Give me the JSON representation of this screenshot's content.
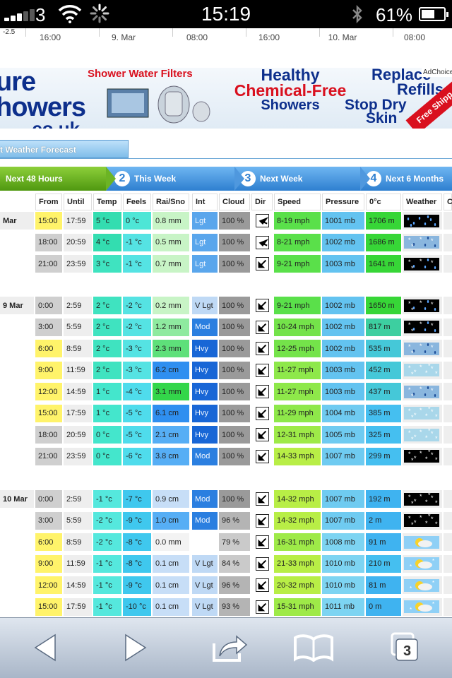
{
  "status_bar": {
    "carrier": "3",
    "time": "15:19",
    "battery": "61%",
    "battery_level": 0.61
  },
  "time_axis": {
    "y_label": "-2.5",
    "ticks": [
      "16:00",
      "9. Mar",
      "08:00",
      "16:00",
      "10. Mar",
      "08:00"
    ]
  },
  "banner": {
    "logo_line1": "ure",
    "logo_line2": "howers",
    "logo_line3": ".co.uk",
    "filters": "Shower Water Filters",
    "healthy1": "Healthy",
    "healthy2": "Chemical-Free",
    "healthy3": "Showers",
    "replace1": "Replace",
    "replace2": "Refills",
    "stop1": "Stop Dry",
    "stop2": "Skin",
    "ad_choices": "AdChoice",
    "free_ship": "Free Shipp"
  },
  "forecast_tab": "t Weather Forecast",
  "steps": [
    {
      "number": "",
      "label": "Next 48 Hours"
    },
    {
      "number": "2",
      "label": "This Week"
    },
    {
      "number": "3",
      "label": "Next Week"
    },
    {
      "number": "4",
      "label": "Next 6 Months"
    }
  ],
  "columns": [
    "From",
    "Until",
    "Temp",
    "Feels",
    "Rai/Sno",
    "Int",
    "Cloud",
    "Dir",
    "Speed",
    "Pressure",
    "0°c",
    "Weather",
    "C"
  ],
  "days": [
    {
      "label": "Mar",
      "rows": [
        {
          "from": "15:00",
          "until": "17:59",
          "temp": "5 °c",
          "feels": "0 °c",
          "precip": "0.8 mm",
          "int": "Lgt",
          "cloud": "100 %",
          "dir": "left",
          "speed": "8-19 mph",
          "pressure": "1001 mb",
          "freeze": "1706 m",
          "weather": "rain-night"
        },
        {
          "from": "18:00",
          "until": "20:59",
          "temp": "4 °c",
          "feels": "-1 °c",
          "precip": "0.5 mm",
          "int": "Lgt",
          "cloud": "100 %",
          "dir": "left",
          "speed": "8-21 mph",
          "pressure": "1002 mb",
          "freeze": "1686 m",
          "weather": "sleet"
        },
        {
          "from": "21:00",
          "until": "23:59",
          "temp": "3 °c",
          "feels": "-1 °c",
          "precip": "0.7 mm",
          "int": "Lgt",
          "cloud": "100 %",
          "dir": "down-left",
          "speed": "9-21 mph",
          "pressure": "1003 mb",
          "freeze": "1641 m",
          "weather": "sleet-night"
        }
      ]
    },
    {
      "label": "9 Mar",
      "rows": [
        {
          "from": "0:00",
          "until": "2:59",
          "temp": "2 °c",
          "feels": "-2 °c",
          "precip": "0.2 mm",
          "int": "V Lgt",
          "cloud": "100 %",
          "dir": "down-left",
          "speed": "9-21 mph",
          "pressure": "1002 mb",
          "freeze": "1650 m",
          "weather": "sleet-night"
        },
        {
          "from": "3:00",
          "until": "5:59",
          "temp": "2 °c",
          "feels": "-2 °c",
          "precip": "1.2 mm",
          "int": "Mod",
          "cloud": "100 %",
          "dir": "down-left",
          "speed": "10-24 mph",
          "pressure": "1002 mb",
          "freeze": "817 m",
          "weather": "sleet-night"
        },
        {
          "from": "6:00",
          "until": "8:59",
          "temp": "2 °c",
          "feels": "-3 °c",
          "precip": "2.3 mm",
          "int": "Hvy",
          "cloud": "100 %",
          "dir": "down-left",
          "speed": "12-25 mph",
          "pressure": "1002 mb",
          "freeze": "535 m",
          "weather": "sleet"
        },
        {
          "from": "9:00",
          "until": "11:59",
          "temp": "2 °c",
          "feels": "-3 °c",
          "precip": "6.2 cm",
          "int": "Hvy",
          "cloud": "100 %",
          "dir": "down-left",
          "speed": "11-27 mph",
          "pressure": "1003 mb",
          "freeze": "452 m",
          "weather": "snow"
        },
        {
          "from": "12:00",
          "until": "14:59",
          "temp": "1 °c",
          "feels": "-4 °c",
          "precip": "3.1 mm",
          "int": "Hvy",
          "cloud": "100 %",
          "dir": "down-left",
          "speed": "11-27 mph",
          "pressure": "1003 mb",
          "freeze": "437 m",
          "weather": "sleet"
        },
        {
          "from": "15:00",
          "until": "17:59",
          "temp": "1 °c",
          "feels": "-5 °c",
          "precip": "6.1 cm",
          "int": "Hvy",
          "cloud": "100 %",
          "dir": "down-left",
          "speed": "11-29 mph",
          "pressure": "1004 mb",
          "freeze": "385 m",
          "weather": "snow"
        },
        {
          "from": "18:00",
          "until": "20:59",
          "temp": "0 °c",
          "feels": "-5 °c",
          "precip": "2.1 cm",
          "int": "Hvy",
          "cloud": "100 %",
          "dir": "down-left",
          "speed": "12-31 mph",
          "pressure": "1005 mb",
          "freeze": "325 m",
          "weather": "snow"
        },
        {
          "from": "21:00",
          "until": "23:59",
          "temp": "0 °c",
          "feels": "-6 °c",
          "precip": "3.8 cm",
          "int": "Mod",
          "cloud": "100 %",
          "dir": "down-left",
          "speed": "14-33 mph",
          "pressure": "1007 mb",
          "freeze": "299 m",
          "weather": "snow-night"
        }
      ]
    },
    {
      "label": "10 Mar",
      "rows": [
        {
          "from": "0:00",
          "until": "2:59",
          "temp": "-1 °c",
          "feels": "-7 °c",
          "precip": "0.9 cm",
          "int": "Mod",
          "cloud": "100 %",
          "dir": "down-left",
          "speed": "14-32 mph",
          "pressure": "1007 mb",
          "freeze": "192 m",
          "weather": "snow-night"
        },
        {
          "from": "3:00",
          "until": "5:59",
          "temp": "-2 °c",
          "feels": "-9 °c",
          "precip": "1.0 cm",
          "int": "Mod",
          "cloud": "96 %",
          "dir": "down-left",
          "speed": "14-32 mph",
          "pressure": "1007 mb",
          "freeze": "2 m",
          "weather": "snow-night"
        },
        {
          "from": "6:00",
          "until": "8:59",
          "temp": "-2 °c",
          "feels": "-8 °c",
          "precip": "0.0 mm",
          "int": "",
          "cloud": "79 %",
          "dir": "down-left",
          "speed": "16-31 mph",
          "pressure": "1008 mb",
          "freeze": "91 m",
          "weather": "sun-cloud"
        },
        {
          "from": "9:00",
          "until": "11:59",
          "temp": "-1 °c",
          "feels": "-8 °c",
          "precip": "0.1 cm",
          "int": "V Lgt",
          "cloud": "84 %",
          "dir": "down-left",
          "speed": "21-33 mph",
          "pressure": "1010 mb",
          "freeze": "210 m",
          "weather": "sun-snow"
        },
        {
          "from": "12:00",
          "until": "14:59",
          "temp": "-1 °c",
          "feels": "-9 °c",
          "precip": "0.1 cm",
          "int": "V Lgt",
          "cloud": "96 %",
          "dir": "down-left",
          "speed": "20-32 mph",
          "pressure": "1010 mb",
          "freeze": "81 m",
          "weather": "sun-snow"
        },
        {
          "from": "15:00",
          "until": "17:59",
          "temp": "-1 °c",
          "feels": "-10 °c",
          "precip": "0.1 cm",
          "int": "V Lgt",
          "cloud": "93 %",
          "dir": "down-left",
          "speed": "15-31 mph",
          "pressure": "1011 mb",
          "freeze": "0 m",
          "weather": "sun-snow"
        }
      ]
    }
  ],
  "toolbar": {
    "tabs_count": "3",
    "icons": [
      "back-icon",
      "forward-icon",
      "share-icon",
      "bookmarks-icon",
      "tabs-icon"
    ]
  },
  "colors": {
    "green_tab": "#5aa51a",
    "blue_tab": "#3a86d4",
    "period_day": "#fff36a",
    "period_night": "#cfcfcf"
  }
}
